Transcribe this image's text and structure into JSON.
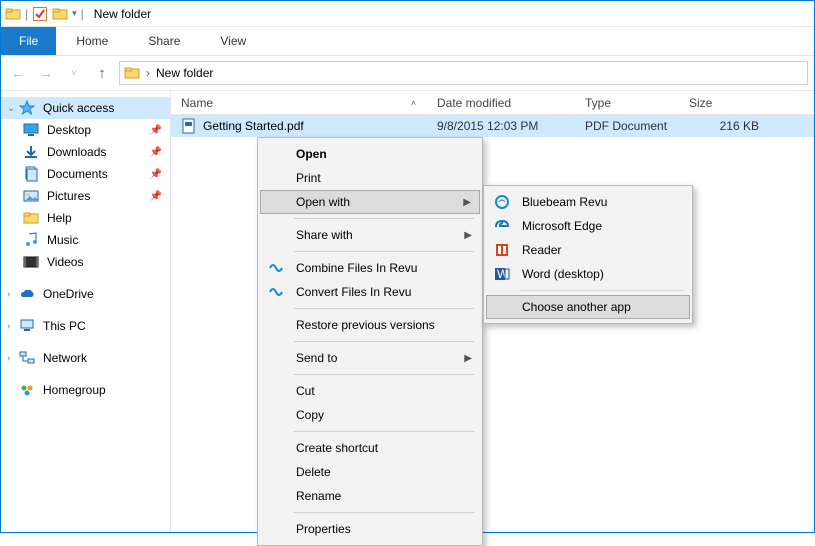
{
  "title": "New folder",
  "tabs": {
    "file": "File",
    "home": "Home",
    "share": "Share",
    "view": "View"
  },
  "breadcrumb": {
    "location": "New folder"
  },
  "columns": {
    "name": "Name",
    "date": "Date modified",
    "type": "Type",
    "size": "Size"
  },
  "sidebar": {
    "quick_access": "Quick access",
    "items": [
      {
        "label": "Desktop",
        "pinned": true
      },
      {
        "label": "Downloads",
        "pinned": true
      },
      {
        "label": "Documents",
        "pinned": true
      },
      {
        "label": "Pictures",
        "pinned": true
      },
      {
        "label": "Help"
      },
      {
        "label": "Music"
      },
      {
        "label": "Videos"
      }
    ],
    "onedrive": "OneDrive",
    "thispc": "This PC",
    "network": "Network",
    "homegroup": "Homegroup"
  },
  "rows": [
    {
      "name": "Getting Started.pdf",
      "date": "9/8/2015 12:03 PM",
      "type": "PDF Document",
      "size": "216 KB"
    }
  ],
  "context": {
    "open": "Open",
    "print": "Print",
    "open_with": "Open with",
    "share_with": "Share with",
    "combine": "Combine Files In Revu",
    "convert": "Convert Files In Revu",
    "restore": "Restore previous versions",
    "send_to": "Send to",
    "cut": "Cut",
    "copy": "Copy",
    "shortcut": "Create shortcut",
    "delete": "Delete",
    "rename": "Rename",
    "properties": "Properties"
  },
  "openwith": {
    "bluebeam": "Bluebeam Revu",
    "edge": "Microsoft Edge",
    "reader": "Reader",
    "word": "Word (desktop)",
    "choose": "Choose another app"
  }
}
